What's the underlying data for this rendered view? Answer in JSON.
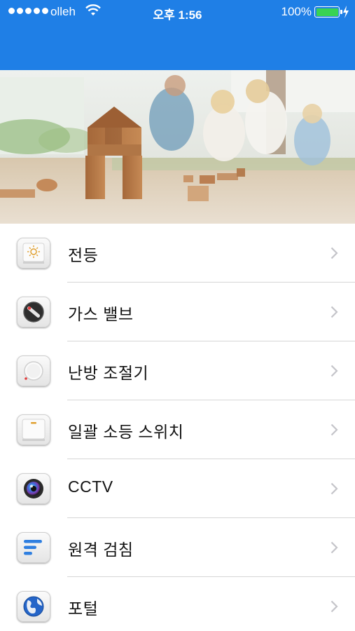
{
  "status_bar": {
    "carrier": "olleh",
    "time": "오후 1:56",
    "battery_percent": "100%",
    "signal_icon": "signal-dots-icon",
    "wifi_icon": "wifi-icon",
    "battery_icon": "battery-icon",
    "charging_icon": "charging-bolt-icon"
  },
  "colors": {
    "nav_blue": "#1f7fe6",
    "battery_green": "#39d353",
    "separator": "#d6d6d6"
  },
  "menu": {
    "items": [
      {
        "label": "전등",
        "icon": "light-icon"
      },
      {
        "label": "가스 밸브",
        "icon": "gas-valve-icon"
      },
      {
        "label": "난방 조절기",
        "icon": "thermostat-icon"
      },
      {
        "label": "일괄 소등 스위치",
        "icon": "switch-icon"
      },
      {
        "label": "CCTV",
        "icon": "camera-icon"
      },
      {
        "label": "원격 검침",
        "icon": "remote-meter-icon"
      },
      {
        "label": "포털",
        "icon": "globe-icon"
      }
    ]
  }
}
